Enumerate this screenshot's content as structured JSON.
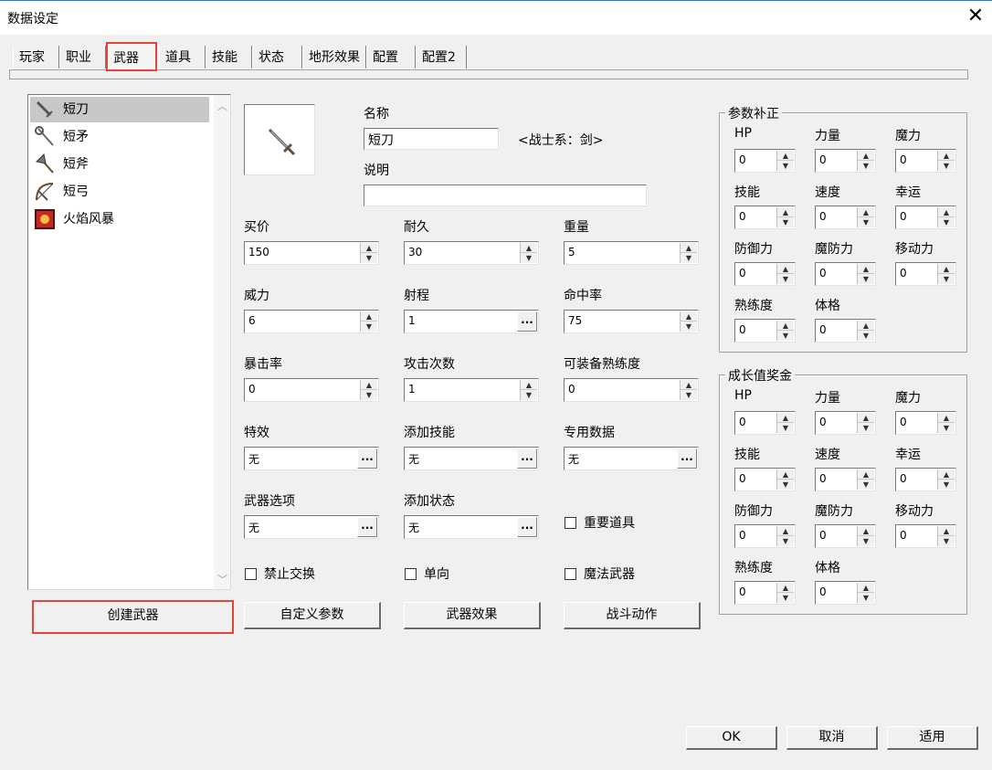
{
  "window": {
    "title": "数据设定",
    "close_icon": "close-icon"
  },
  "tabs": [
    {
      "label": "玩家",
      "active": false
    },
    {
      "label": "职业",
      "active": false
    },
    {
      "label": "武器",
      "active": true
    },
    {
      "label": "道具",
      "active": false
    },
    {
      "label": "技能",
      "active": false
    },
    {
      "label": "状态",
      "active": false
    },
    {
      "label": "地形效果",
      "active": false
    },
    {
      "label": "配置",
      "active": false
    },
    {
      "label": "配置2",
      "active": false
    }
  ],
  "weapon_list": [
    {
      "name": "短刀",
      "icon": "dagger-icon",
      "selected": true
    },
    {
      "name": "短矛",
      "icon": "spear-icon",
      "selected": false
    },
    {
      "name": "短斧",
      "icon": "axe-icon",
      "selected": false
    },
    {
      "name": "短弓",
      "icon": "bow-icon",
      "selected": false
    },
    {
      "name": "火焰风暴",
      "icon": "tome-icon",
      "selected": false
    }
  ],
  "detail": {
    "name_label": "名称",
    "name_value": "短刀",
    "category": "<战士系：剑>",
    "desc_label": "说明",
    "desc_value": "",
    "fields": {
      "price": {
        "label": "买价",
        "value": "150"
      },
      "durability": {
        "label": "耐久",
        "value": "30"
      },
      "weight": {
        "label": "重量",
        "value": "5"
      },
      "might": {
        "label": "威力",
        "value": "6"
      },
      "range": {
        "label": "射程",
        "value": "1"
      },
      "hit": {
        "label": "命中率",
        "value": "75"
      },
      "crit": {
        "label": "暴击率",
        "value": "0"
      },
      "attacks": {
        "label": "攻击次数",
        "value": "1"
      },
      "mastery": {
        "label": "可装备熟练度",
        "value": "0"
      },
      "effect": {
        "label": "特效",
        "value": "无"
      },
      "add_skill": {
        "label": "添加技能",
        "value": "无"
      },
      "custom_data": {
        "label": "专用数据",
        "value": "无"
      },
      "options": {
        "label": "武器选项",
        "value": "无"
      },
      "add_state": {
        "label": "添加状态",
        "value": "无"
      }
    },
    "checks": {
      "important": {
        "label": "重要道具",
        "checked": false
      },
      "no_trade": {
        "label": "禁止交换",
        "checked": false
      },
      "one_way": {
        "label": "单向",
        "checked": false
      },
      "magic": {
        "label": "魔法武器",
        "checked": false
      }
    }
  },
  "param_bonus": {
    "title": "参数补正",
    "items": [
      {
        "label": "HP",
        "value": "0"
      },
      {
        "label": "力量",
        "value": "0"
      },
      {
        "label": "魔力",
        "value": "0"
      },
      {
        "label": "技能",
        "value": "0"
      },
      {
        "label": "速度",
        "value": "0"
      },
      {
        "label": "幸运",
        "value": "0"
      },
      {
        "label": "防御力",
        "value": "0"
      },
      {
        "label": "魔防力",
        "value": "0"
      },
      {
        "label": "移动力",
        "value": "0"
      },
      {
        "label": "熟练度",
        "value": "0"
      },
      {
        "label": "体格",
        "value": "0"
      }
    ]
  },
  "growth_bonus": {
    "title": "成长值奖金",
    "items": [
      {
        "label": "HP",
        "value": "0"
      },
      {
        "label": "力量",
        "value": "0"
      },
      {
        "label": "魔力",
        "value": "0"
      },
      {
        "label": "技能",
        "value": "0"
      },
      {
        "label": "速度",
        "value": "0"
      },
      {
        "label": "幸运",
        "value": "0"
      },
      {
        "label": "防御力",
        "value": "0"
      },
      {
        "label": "魔防力",
        "value": "0"
      },
      {
        "label": "移动力",
        "value": "0"
      },
      {
        "label": "熟练度",
        "value": "0"
      },
      {
        "label": "体格",
        "value": "0"
      }
    ]
  },
  "buttons": {
    "create": "创建武器",
    "custom_params": "自定义参数",
    "weapon_effect": "武器效果",
    "battle_motion": "战斗动作",
    "ok": "OK",
    "cancel": "取消",
    "apply": "适用"
  },
  "colors": {
    "highlight": "#e0473a",
    "title_accent": "#1e7bd8"
  }
}
